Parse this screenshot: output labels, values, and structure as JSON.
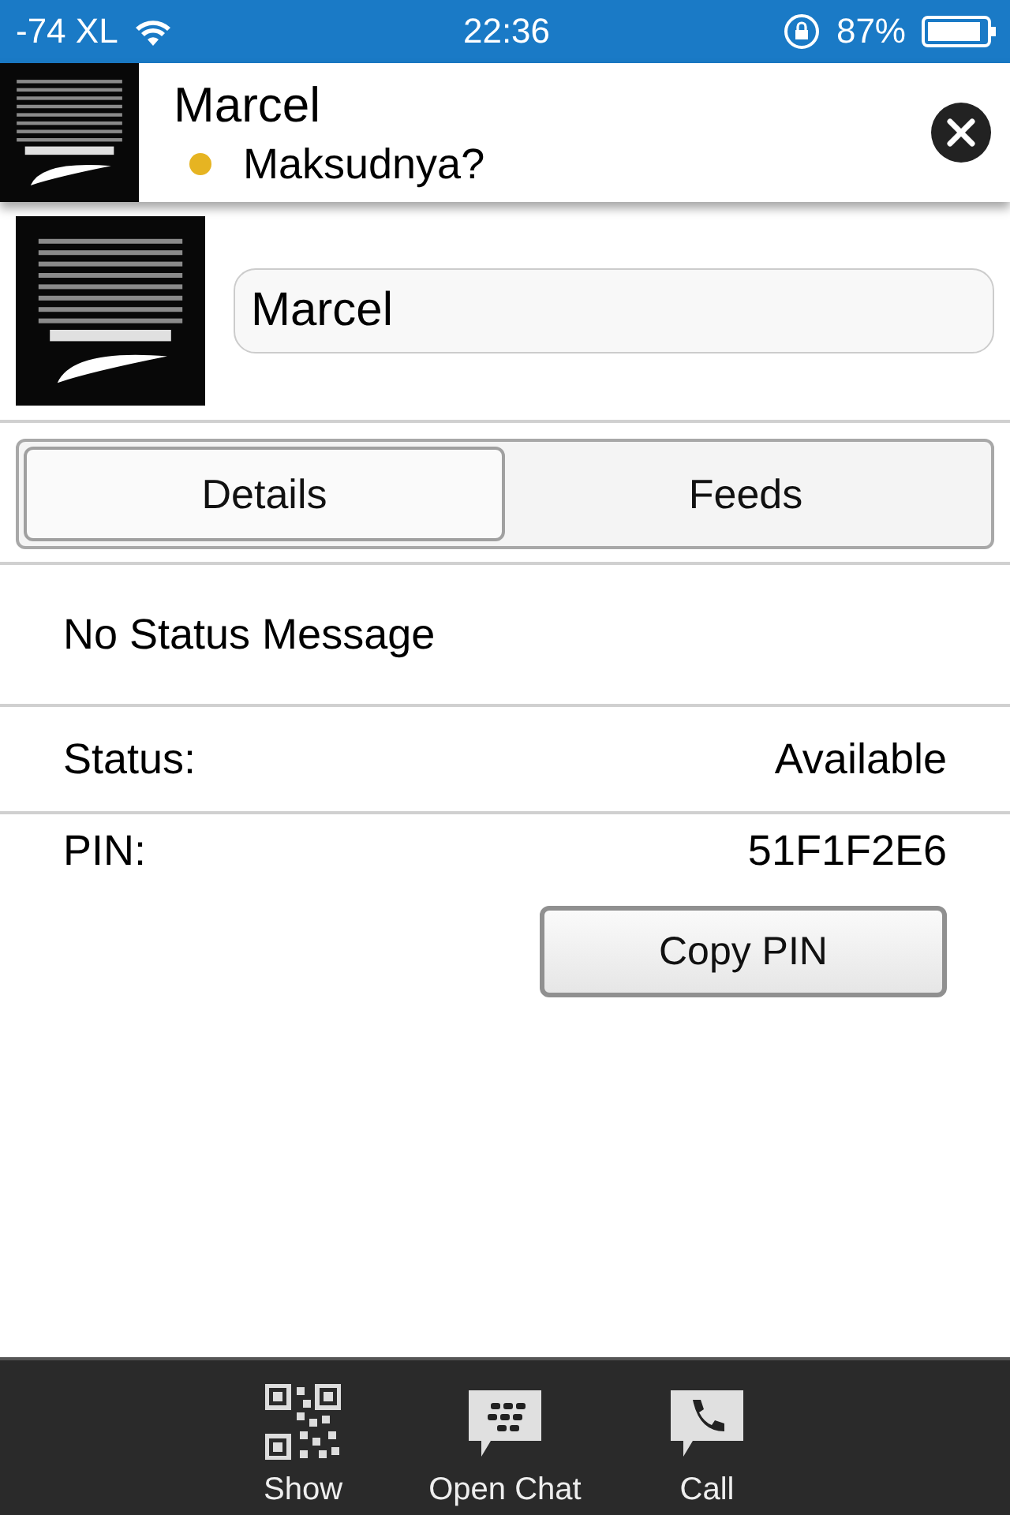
{
  "status_bar": {
    "carrier": "-74 XL",
    "time": "22:36",
    "battery": "87%"
  },
  "chat_header": {
    "name": "Marcel",
    "message": "Maksudnya?",
    "status_dot": {
      "color": "#e6b422"
    }
  },
  "profile": {
    "display_name": "Marcel"
  },
  "tabs": [
    {
      "label": "Details",
      "selected": true
    },
    {
      "label": "Feeds",
      "selected": false
    }
  ],
  "status_message": "No Status Message",
  "details": [
    {
      "label": "Status:",
      "value": "Available"
    },
    {
      "label": "PIN:",
      "value": "51F1F2E6"
    }
  ],
  "copy_button": "Copy PIN",
  "toolbar": [
    {
      "kind": "qr",
      "label": "Show"
    },
    {
      "kind": "chat",
      "label": "Open Chat"
    },
    {
      "kind": "call",
      "label": "Call"
    }
  ]
}
